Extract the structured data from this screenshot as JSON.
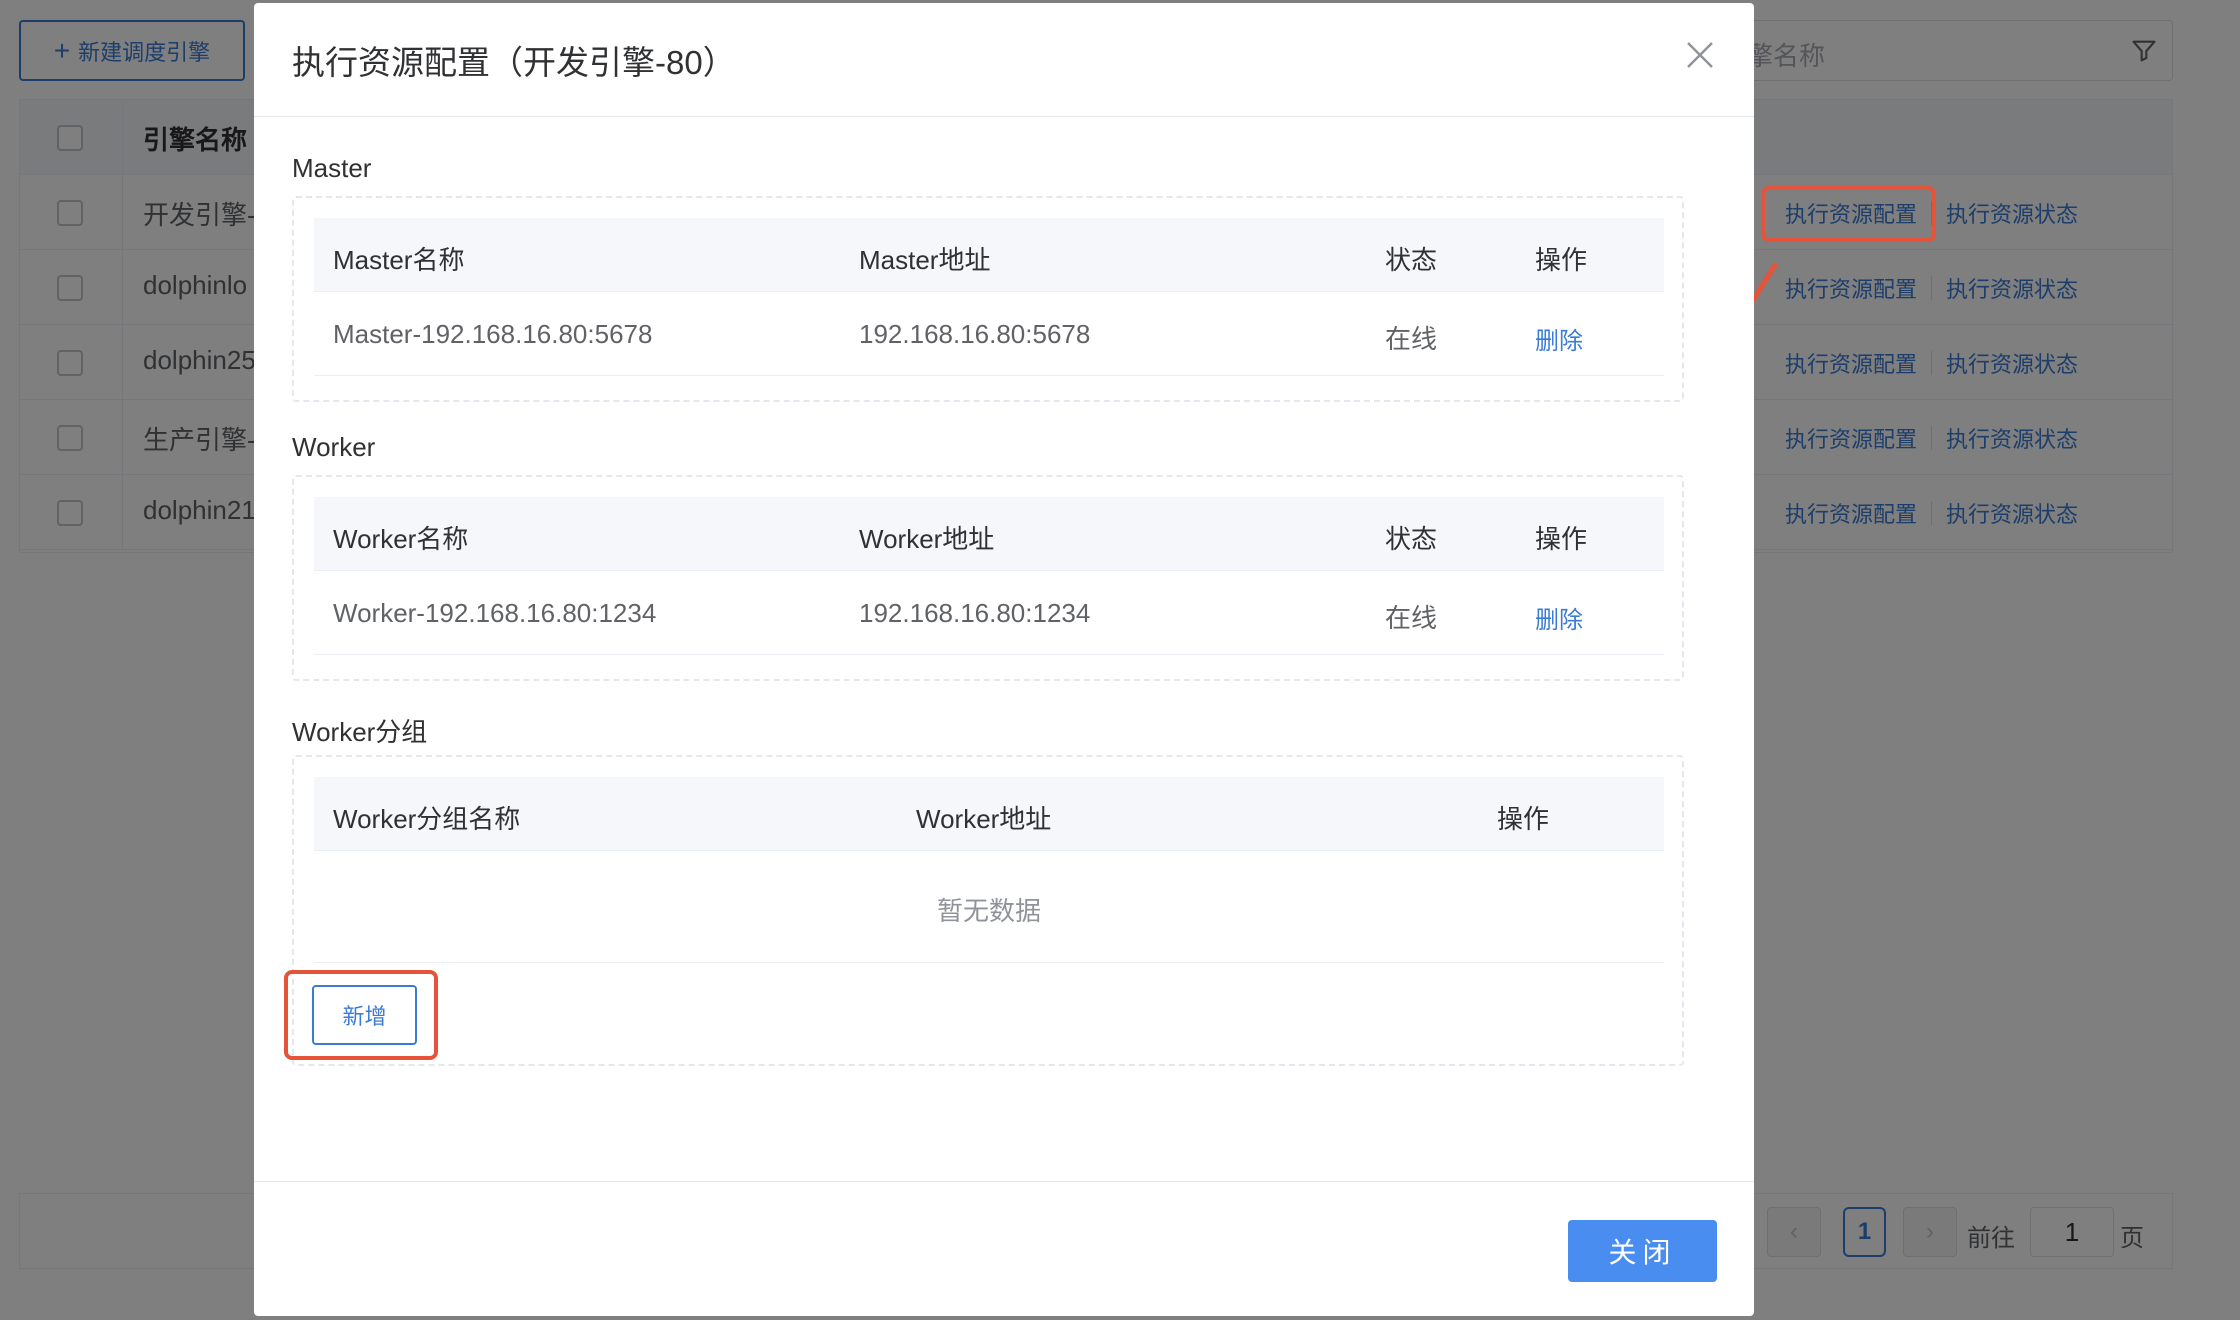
{
  "toolbar": {
    "new_engine_label": "新建调度引擎",
    "search_placeholder": "擎名称"
  },
  "table": {
    "header_name": "引擎名称",
    "rows": [
      {
        "name": "开发引擎-",
        "config": "执行资源配置",
        "status": "执行资源状态"
      },
      {
        "name": "dolphinlo",
        "config": "执行资源配置",
        "status": "执行资源状态"
      },
      {
        "name": "dolphin25",
        "config": "执行资源配置",
        "status": "执行资源状态"
      },
      {
        "name": "生产引擎-",
        "config": "执行资源配置",
        "status": "执行资源状态"
      },
      {
        "name": "dolphin21",
        "config": "执行资源配置",
        "status": "执行资源状态"
      }
    ]
  },
  "pagination": {
    "prev": "‹",
    "current": "1",
    "next": "›",
    "goto_label": "前往",
    "goto_value": "1",
    "page_suffix": "页"
  },
  "dialog": {
    "title": "执行资源配置（开发引擎-80）",
    "master": {
      "section_label": "Master",
      "headers": {
        "name": "Master名称",
        "address": "Master地址",
        "status": "状态",
        "action": "操作"
      },
      "rows": [
        {
          "name": "Master-192.168.16.80:5678",
          "address": "192.168.16.80:5678",
          "status": "在线",
          "action": "删除"
        }
      ]
    },
    "worker": {
      "section_label": "Worker",
      "headers": {
        "name": "Worker名称",
        "address": "Worker地址",
        "status": "状态",
        "action": "操作"
      },
      "rows": [
        {
          "name": "Worker-192.168.16.80:1234",
          "address": "192.168.16.80:1234",
          "status": "在线",
          "action": "删除"
        }
      ]
    },
    "worker_group": {
      "section_label": "Worker分组",
      "headers": {
        "name": "Worker分组名称",
        "address": "Worker地址",
        "action": "操作"
      },
      "empty_text": "暂无数据",
      "add_label": "新增"
    },
    "close_label": "关闭"
  },
  "colors": {
    "primary": "#3a7bd5",
    "primary_button": "#4a8df0",
    "annotation": "#e5543a",
    "mask": "rgba(0,0,0,0.5)"
  }
}
